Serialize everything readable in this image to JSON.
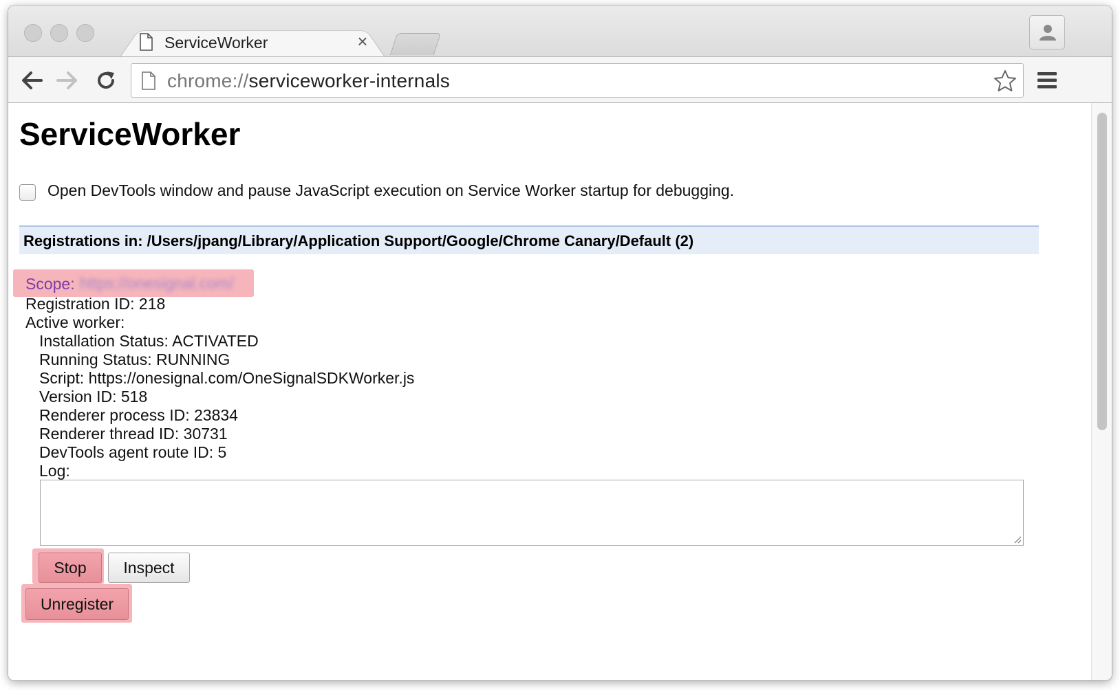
{
  "browser": {
    "tab": {
      "title": "ServiceWorker",
      "close": "×"
    },
    "address": {
      "scheme": "chrome://",
      "path": "serviceworker-internals"
    }
  },
  "page": {
    "title": "ServiceWorker",
    "debug_checkbox": {
      "label": "Open DevTools window and pause JavaScript execution on Service Worker startup for debugging.",
      "checked": false
    },
    "registrations_header": "Registrations in: /Users/jpang/Library/Application Support/Google/Chrome Canary/Default (2)",
    "registration": {
      "scope_label": "Scope:",
      "scope_value": "https://onesignal.com/",
      "registration_id": "Registration ID: 218",
      "active_worker_label": "Active worker:",
      "installation_status": "Installation Status: ACTIVATED",
      "running_status": "Running Status: RUNNING",
      "script": "Script: https://onesignal.com/OneSignalSDKWorker.js",
      "version_id": "Version ID: 518",
      "renderer_process_id": "Renderer process ID: 23834",
      "renderer_thread_id": "Renderer thread ID: 30731",
      "devtools_route_id": "DevTools agent route ID: 5",
      "log_label": "Log:",
      "log_value": ""
    },
    "buttons": {
      "stop": "Stop",
      "inspect": "Inspect",
      "unregister": "Unregister"
    }
  },
  "colors": {
    "highlight": "#f6b4bb",
    "header_bg": "#e5edf8",
    "scope_label": "#7d3da8"
  },
  "icons": [
    "page-icon",
    "close-icon",
    "profile-icon",
    "back-icon",
    "forward-icon",
    "reload-icon",
    "star-icon",
    "menu-icon"
  ]
}
